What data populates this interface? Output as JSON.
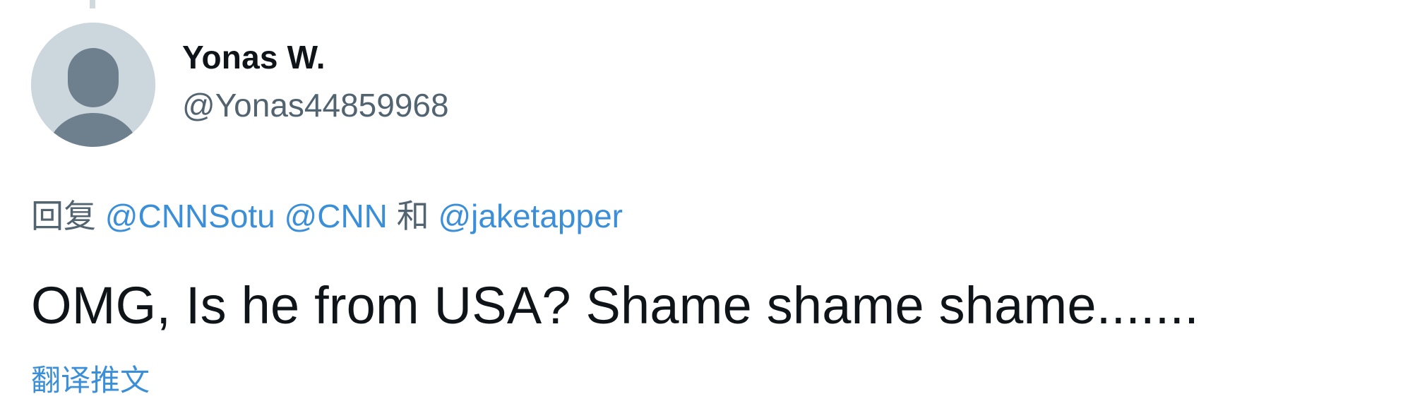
{
  "tweet": {
    "author": {
      "display_name": "Yonas W.",
      "handle": "@Yonas44859968",
      "avatar_icon": "default-profile-icon"
    },
    "reply": {
      "prefix": "回复",
      "mentions": [
        "@CNNSotu",
        "@CNN",
        "@jaketapper"
      ],
      "conjunction": "和"
    },
    "text": "OMG, Is he from USA? Shame shame shame.......",
    "translate_label": "翻译推文"
  },
  "colors": {
    "text_primary": "#0f1419",
    "text_secondary": "#536471",
    "link": "#3a8fd8",
    "avatar_bg": "#ccd6dd",
    "avatar_figure": "#6e7f8d"
  }
}
